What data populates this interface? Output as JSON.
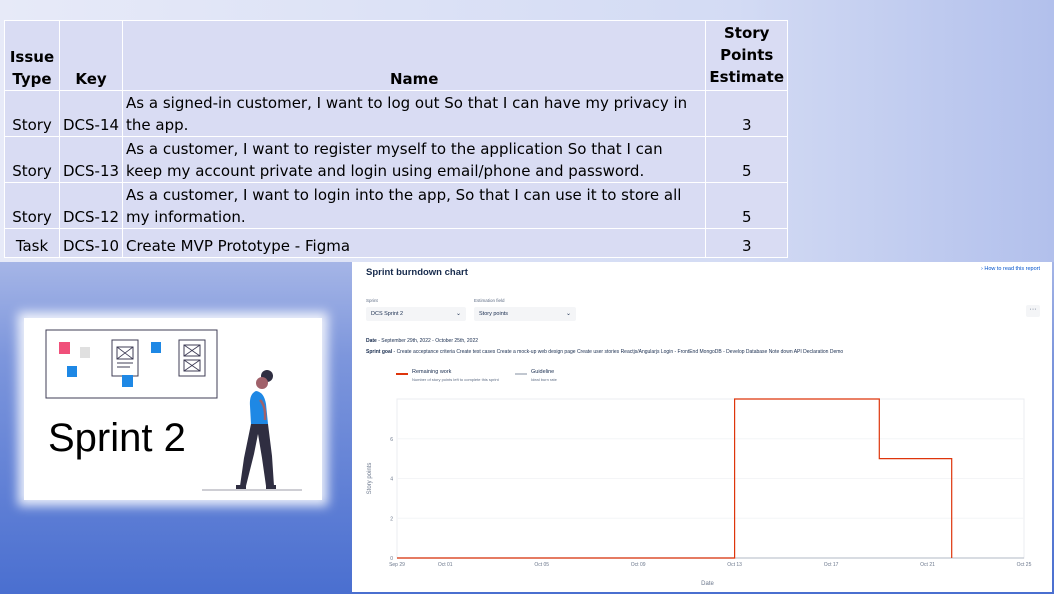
{
  "table": {
    "headers": {
      "issue_type": "Issue Type",
      "key": "Key",
      "name": "Name",
      "story_points": "Story Points Estimate"
    },
    "rows": [
      {
        "type": "Story",
        "key": "DCS-14",
        "name": "As a signed-in customer, I want to log out So that I can have my privacy in the app.",
        "points": "3"
      },
      {
        "type": "Story",
        "key": "DCS-13",
        "name": "As a customer, I want to register myself to the application So that I can keep my account private and login using email/phone and password.",
        "points": "5"
      },
      {
        "type": "Story",
        "key": "DCS-12",
        "name": "As a customer, I want to login into the app, So that I can use it to store all my information.",
        "points": "5"
      },
      {
        "type": "Task",
        "key": "DCS-10",
        "name": "Create MVP Prototype - Figma",
        "points": "3"
      }
    ]
  },
  "illustration": {
    "caption": "Sprint 2"
  },
  "burndown": {
    "title": "Sprint burndown chart",
    "how_to_link": "› How to read this report",
    "sprint_label": "Sprint",
    "sprint_value": "DCS Sprint 2",
    "estimation_label": "Estimation field",
    "estimation_value": "Story points",
    "more_label": "···",
    "date_label": "Date",
    "date_value": " - September 29th, 2022 - October 25th, 2022",
    "goal_label": "Sprint goal",
    "goal_value": " - Create acceptance criteria Create test cases Create a mock-up web design page Create user stories Reactjs/Angularjs Login - FrontEnd MongoDB - Develop Database Note down API Declaration Demo",
    "legend": [
      {
        "name": "Remaining work",
        "desc": "Number of story points left to complete this sprint",
        "color": "#de350b"
      },
      {
        "name": "Guideline",
        "desc": "Ideal burn rate",
        "color": "#c1c7d0"
      }
    ]
  },
  "chart_data": {
    "type": "line",
    "xlabel": "Date",
    "ylabel": "Story points",
    "x_ticks": [
      "Sep 29",
      "Oct 01",
      "Oct 05",
      "Oct 09",
      "Oct 13",
      "Oct 17",
      "Oct 21",
      "Oct 25"
    ],
    "y_ticks": [
      "0",
      "2",
      "4",
      "6"
    ],
    "ylim": [
      0,
      8
    ],
    "xlim": [
      "Sep 29",
      "Oct 25"
    ],
    "grid": true,
    "series": [
      {
        "name": "Remaining work",
        "color": "#de350b",
        "step": true,
        "points": [
          {
            "x": "Sep 29",
            "y": 0
          },
          {
            "x": "Oct 13",
            "y": 0
          },
          {
            "x": "Oct 13",
            "y": 8
          },
          {
            "x": "Oct 19",
            "y": 8
          },
          {
            "x": "Oct 19",
            "y": 5
          },
          {
            "x": "Oct 22",
            "y": 5
          },
          {
            "x": "Oct 22",
            "y": 0
          }
        ]
      },
      {
        "name": "Guideline",
        "color": "#c1c7d0",
        "points": [
          {
            "x": "Sep 29",
            "y": 0
          },
          {
            "x": "Oct 25",
            "y": 0
          }
        ]
      }
    ]
  }
}
